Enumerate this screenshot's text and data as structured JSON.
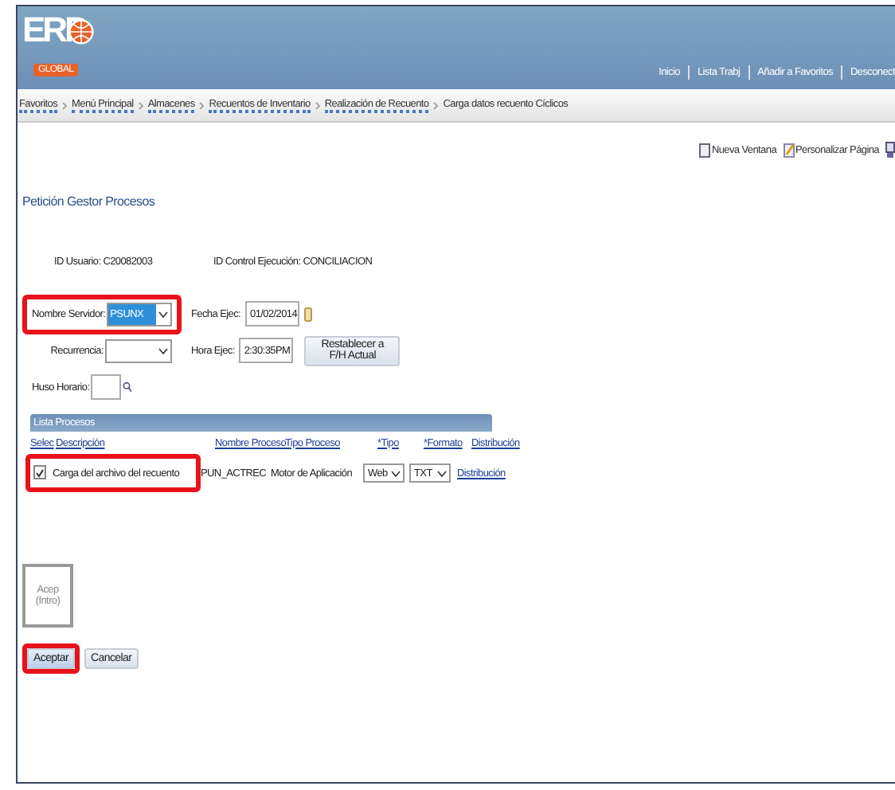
{
  "header": {
    "logo": {
      "main": "ERP",
      "sub": "GLOBAL"
    },
    "links": [
      "Inicio",
      "Lista Trabj",
      "Añadir a Favoritos",
      "Desconect"
    ]
  },
  "breadcrumb": [
    {
      "label": "Favoritos",
      "menu": true
    },
    {
      "label": "Menú Principal",
      "menu": true
    },
    {
      "label": "Almacenes",
      "menu": true
    },
    {
      "label": "Recuentos de Inventario",
      "menu": true
    },
    {
      "label": "Realización de Recuento",
      "menu": true
    },
    {
      "label": "Carga datos recuento Cíclicos",
      "menu": false
    }
  ],
  "page_links": [
    "Nueva Ventana",
    "Personalizar Página"
  ],
  "title": "Petición Gestor Procesos",
  "info": [
    {
      "label": "ID Usuario:",
      "value": "C20082003"
    },
    {
      "label": "ID Control Ejecución:",
      "value": "CONCILIACION"
    }
  ],
  "form": {
    "server": {
      "label": "Nombre Servidor:",
      "value": "PSUNX",
      "highlighted": true
    },
    "date": {
      "label": "Fecha Ejec:",
      "value": "01/02/2014"
    },
    "recurrence": {
      "label": "Recurrencia:"
    },
    "time": {
      "label": "Hora Ejec:",
      "value": "2:30:35PM"
    },
    "reset_button": "Restablecer a F/H Actual",
    "timezone": {
      "label": "Huso Horario:"
    }
  },
  "process_list": {
    "title": "Lista Procesos",
    "columns": [
      "Selec",
      "Descripción",
      "Nombre Proceso",
      "Tipo Proceso",
      "*Tipo",
      "*Formato",
      "Distribución"
    ],
    "rows": [
      {
        "checked": true,
        "highlighted": true,
        "description": "Carga del archivo del recuento",
        "name": "PUN_ACTREC",
        "process_type": "Motor de Aplicación",
        "type": "Web",
        "format": "TXT",
        "distribution": "Distribución"
      }
    ]
  },
  "tooltip": "Acep (Intro)",
  "buttons": [
    {
      "label": "Aceptar",
      "highlighted": true
    },
    {
      "label": "Cancelar",
      "highlighted": false
    }
  ]
}
